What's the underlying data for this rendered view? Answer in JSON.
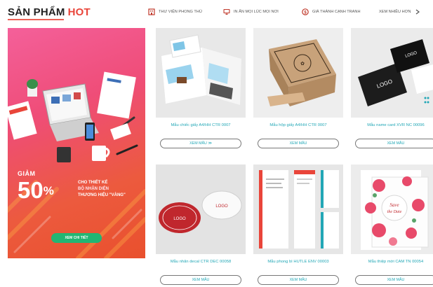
{
  "header": {
    "title_part1": "SẢN PHẨM",
    "title_part2": "HOT",
    "nav": [
      {
        "label": "THƯ VIỆN PHONG THỦ",
        "icon": "building-icon"
      },
      {
        "label": "IN ẤN MỌI LÚC MỌI NƠI",
        "icon": "monitor-icon"
      },
      {
        "label": "GIÁ THÀNH CẠNH TRANH",
        "icon": "price-tag-icon"
      },
      {
        "label": "XEM NHIỀU HƠN",
        "icon": "arrow-right-icon"
      }
    ],
    "accent": "#e9453a"
  },
  "banner": {
    "giam": "GIẢM",
    "percent": "50",
    "percent_sign": "%",
    "line1": "CHO THIẾT KẾ",
    "line2": "BỘ NHẬN DIỆN",
    "line3": "THƯƠNG HIỆU \"VÀNG\"",
    "cta": "XEM CHI TIẾT",
    "cta_color": "#22b573"
  },
  "products": [
    {
      "name": "Mẫu chiếc giấy A4/HH CTR 0007",
      "button": "XEM MẪU ≫"
    },
    {
      "name": "Mẫu hộp giấy A4/HH CTR 0007",
      "button": "XEM MẪU"
    },
    {
      "name": "Mẫu name card XVR NC 00096",
      "button": "XEM MẪU"
    },
    {
      "name": "Mẫu nhãn decal CTR DEC 00058",
      "button": "XEM MẪU"
    },
    {
      "name": "Mẫu phong bì HUTLE ENV 00003",
      "button": "XEM MẪU"
    },
    {
      "name": "Mẫu thiệp mời CAM TN 00054",
      "button": "XEM MẪU"
    }
  ],
  "colors": {
    "product_text": "#22a7b6"
  }
}
